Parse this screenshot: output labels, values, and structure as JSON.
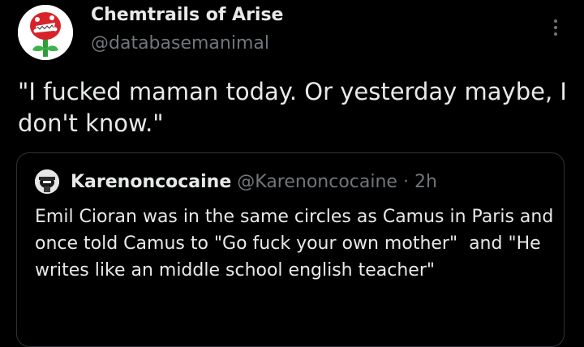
{
  "post": {
    "author_name": "Chemtrails of Arise",
    "author_handle": "@databasemanimal",
    "text": "\"I fucked maman today. Or yesterday maybe, I don't know.\"",
    "more_icon": "more-vertical-icon",
    "avatar_icon": "piranha-plant-icon"
  },
  "quote": {
    "author_name": "Karenoncocaine",
    "author_handle": "@Karenoncocaine",
    "separator": "·",
    "time": "2h",
    "text": "Emil Cioran was in the same circles as Camus in Paris and once told Camus to \"Go fuck your own mother\"  and \"He writes like an middle school english teacher\""
  },
  "colors": {
    "background": "#000000",
    "primary_text": "#e7e9ea",
    "secondary_text": "#71767b",
    "border": "#2f3336"
  }
}
